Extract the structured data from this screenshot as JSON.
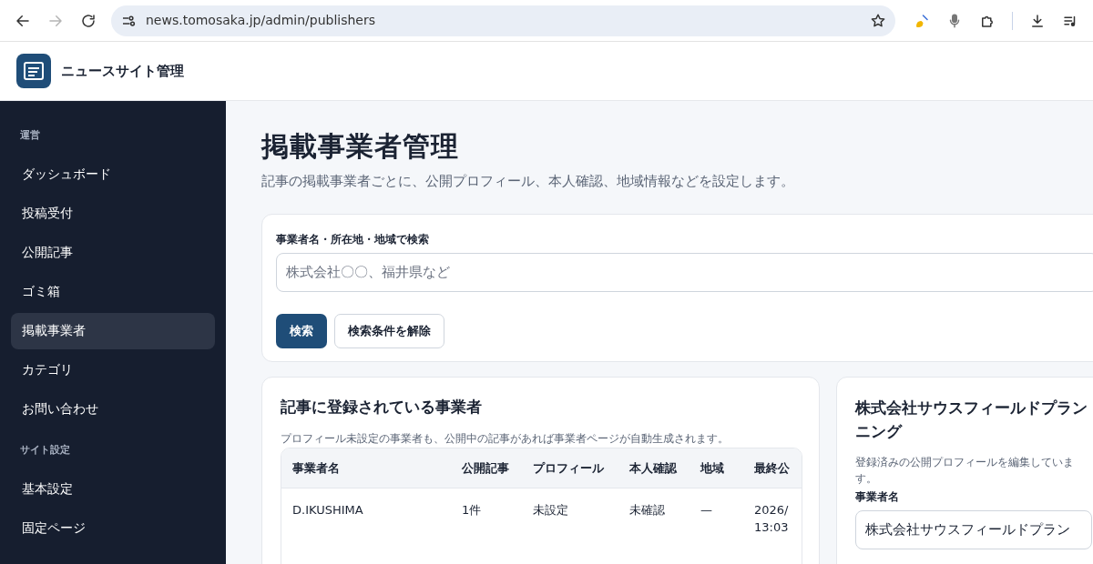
{
  "browser": {
    "url": "news.tomosaka.jp/admin/publishers",
    "nav": [
      {
        "kind": "back",
        "disabled": false
      },
      {
        "kind": "forward",
        "disabled": true
      },
      {
        "kind": "reload",
        "disabled": false
      }
    ],
    "tools": [
      {
        "kind": "brush"
      },
      {
        "kind": "mic"
      },
      {
        "kind": "puzzle"
      },
      {
        "kind": "divider"
      },
      {
        "kind": "download"
      },
      {
        "kind": "media"
      }
    ]
  },
  "app": {
    "title": "ニュースサイト管理"
  },
  "sidebar": {
    "sections": [
      {
        "heading": "運営",
        "items": [
          {
            "label": "ダッシュボード",
            "selected": false
          },
          {
            "label": "投稿受付",
            "selected": false
          },
          {
            "label": "公開記事",
            "selected": false
          },
          {
            "label": "ゴミ箱",
            "selected": false
          },
          {
            "label": "掲載事業者",
            "selected": true
          },
          {
            "label": "カテゴリ",
            "selected": false
          },
          {
            "label": "お問い合わせ",
            "selected": false
          }
        ]
      },
      {
        "heading": "サイト設定",
        "items": [
          {
            "label": "基本設定",
            "selected": false
          },
          {
            "label": "固定ページ",
            "selected": false
          }
        ]
      }
    ]
  },
  "page": {
    "title": "掲載事業者管理",
    "subtitle": "記事の掲載事業者ごとに、公開プロフィール、本人確認、地域情報などを設定します。"
  },
  "search": {
    "label": "事業者名・所在地・地域で検索",
    "placeholder": "株式会社〇〇、福井県など",
    "buttons": [
      {
        "label": "検索",
        "kind": "primary"
      },
      {
        "label": "検索条件を解除",
        "kind": "secondary"
      }
    ]
  },
  "publishers": {
    "title": "記事に登録されている事業者",
    "note": "プロフィール未設定の事業者も、公開中の記事があれば事業者ページが自動生成されます。",
    "columns": [
      "事業者名",
      "公開記事",
      "プロフィール",
      "本人確認",
      "地域",
      "最終公"
    ],
    "rows": [
      {
        "cells": [
          "D.IKUSHIMA",
          "1件",
          "未設定",
          "未確認",
          "—",
          "2026/\n13:03"
        ]
      }
    ]
  },
  "editor": {
    "title": "株式会社サウスフィールドプランニング",
    "note": "登録済みの公開プロフィールを編集しています。",
    "fields": [
      {
        "label": "事業者名",
        "value": "株式会社サウスフィールドプラン"
      }
    ]
  }
}
